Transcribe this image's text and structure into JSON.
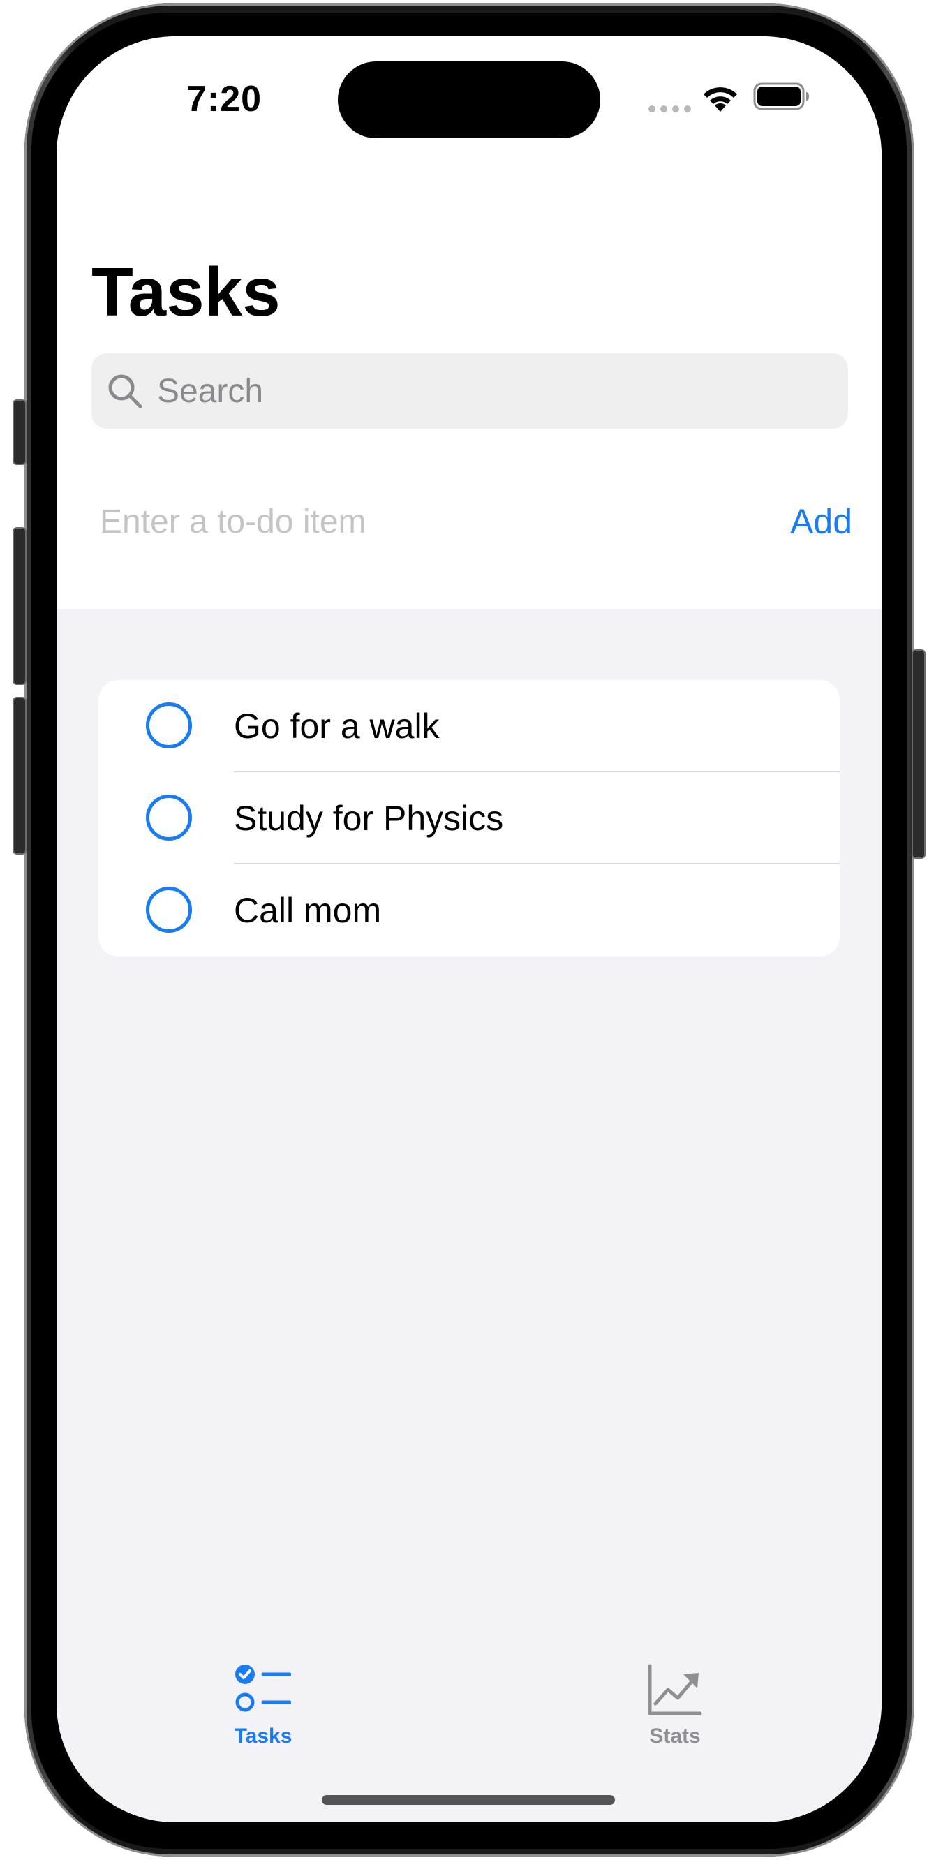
{
  "status_bar": {
    "time": "7:20"
  },
  "nav": {
    "title": "Tasks"
  },
  "search": {
    "placeholder": "Search",
    "value": ""
  },
  "new_todo": {
    "placeholder": "Enter a to-do item",
    "value": "",
    "add_label": "Add"
  },
  "tasks": [
    {
      "title": "Go for a walk",
      "completed": false
    },
    {
      "title": "Study for Physics",
      "completed": false
    },
    {
      "title": "Call mom",
      "completed": false
    }
  ],
  "tab_bar": {
    "tabs": [
      {
        "label": "Tasks",
        "icon": "checklist-icon",
        "selected": true
      },
      {
        "label": "Stats",
        "icon": "chart-line-uptrend-icon",
        "selected": false
      }
    ]
  },
  "colors": {
    "accent": "#1a7cf2",
    "inactive": "#8e8e93",
    "grouped_background": "#f2f2f7"
  }
}
